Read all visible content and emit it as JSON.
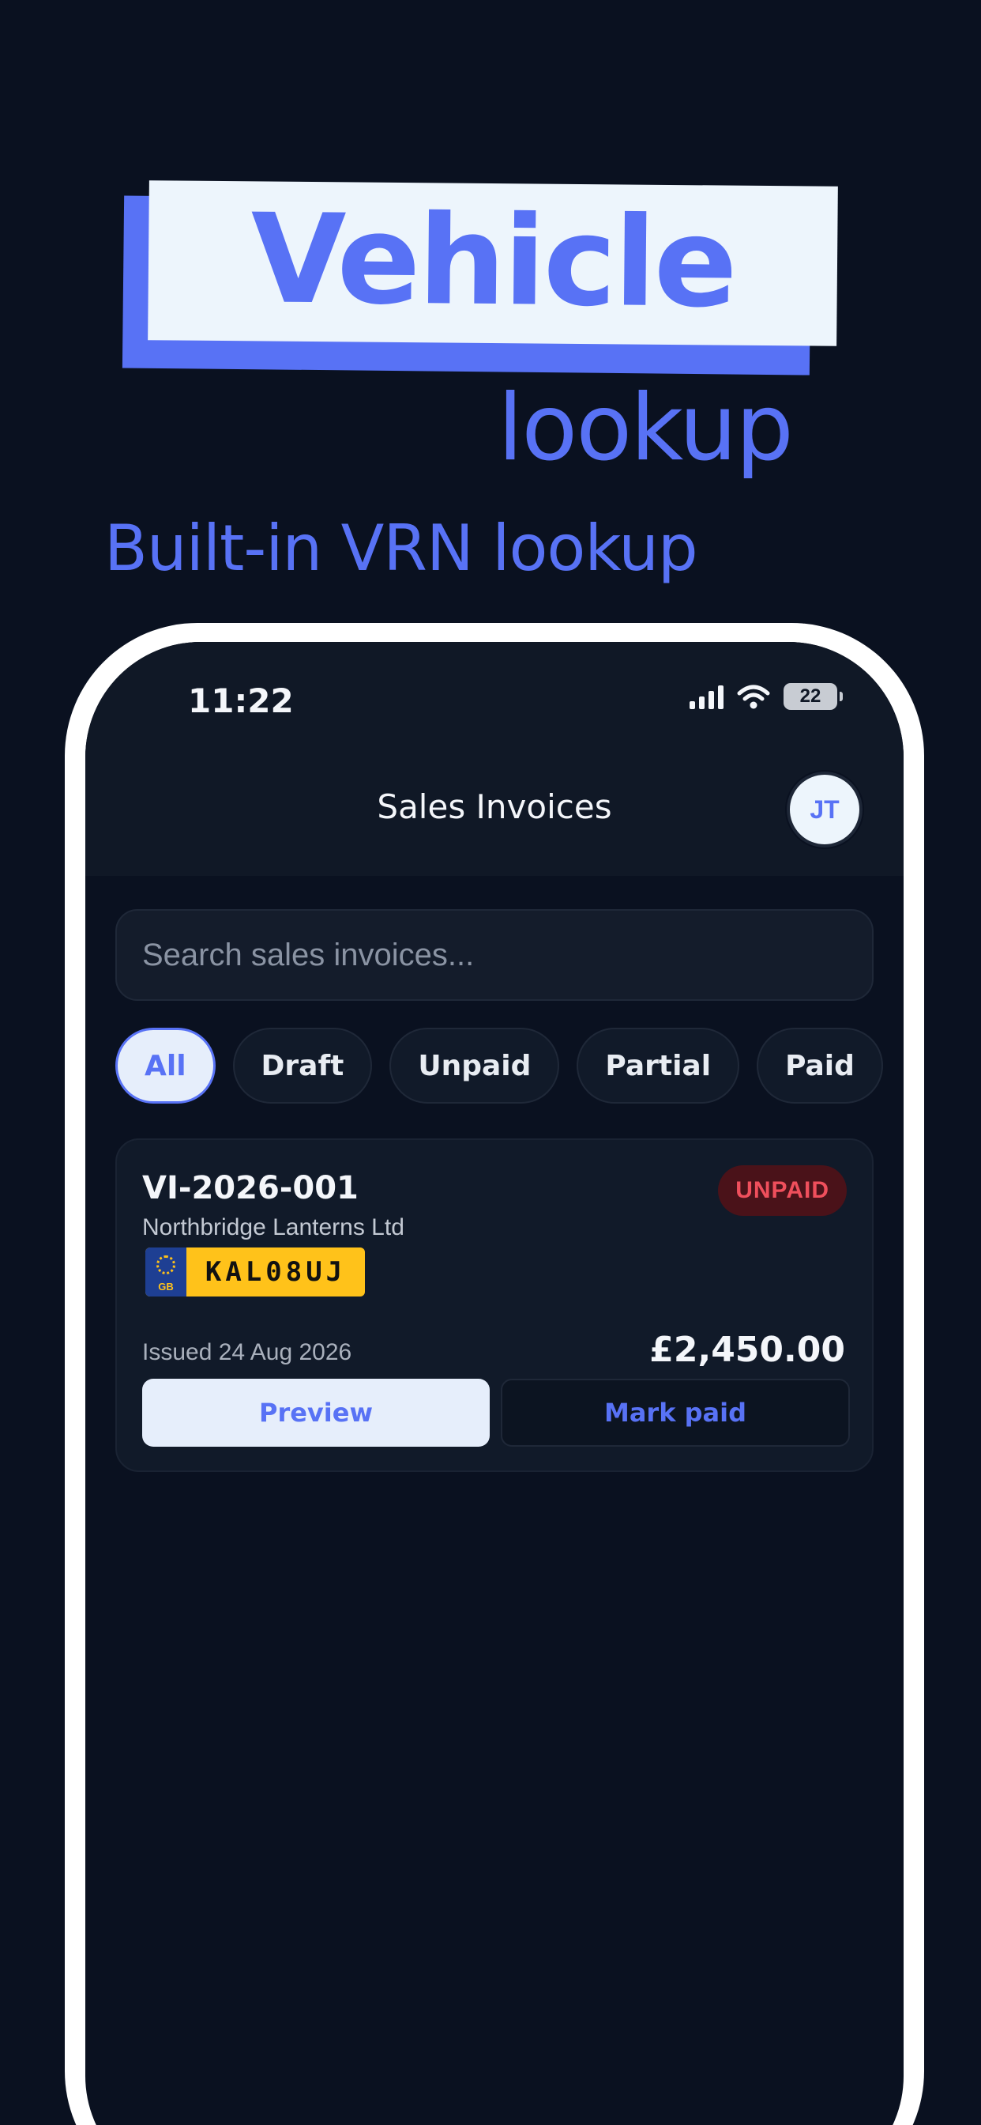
{
  "marketing": {
    "headline": "Vehicle",
    "subheadline": "lookup",
    "tagline": "Built-in VRN lookup"
  },
  "status_bar": {
    "time": "11:22",
    "battery": "22",
    "icons": [
      "signal-icon",
      "wifi-icon",
      "battery-icon"
    ]
  },
  "header": {
    "title": "Sales Invoices",
    "avatar_initials": "JT"
  },
  "search": {
    "placeholder": "Search sales invoices..."
  },
  "filters": {
    "selected": "All",
    "items": [
      "All",
      "Draft",
      "Unpaid",
      "Partial",
      "Paid"
    ]
  },
  "invoices": [
    {
      "number": "VI-2026-001",
      "client": "Northbridge Lanterns Ltd",
      "status": "UNPAID",
      "plate": {
        "country": "GB",
        "registration": "KAL08UJ"
      },
      "issued": "Issued 24 Aug 2026",
      "amount": "£2,450.00",
      "actions": {
        "preview": "Preview",
        "mark_paid": "Mark paid"
      }
    }
  ],
  "colors": {
    "background": "#0a1120",
    "accent": "#5872f5",
    "unpaid_badge_text": "#ef4f5c",
    "unpaid_badge_bg": "#4a1219",
    "plate_yellow": "#ffc21a",
    "plate_band": "#1e3f93"
  }
}
